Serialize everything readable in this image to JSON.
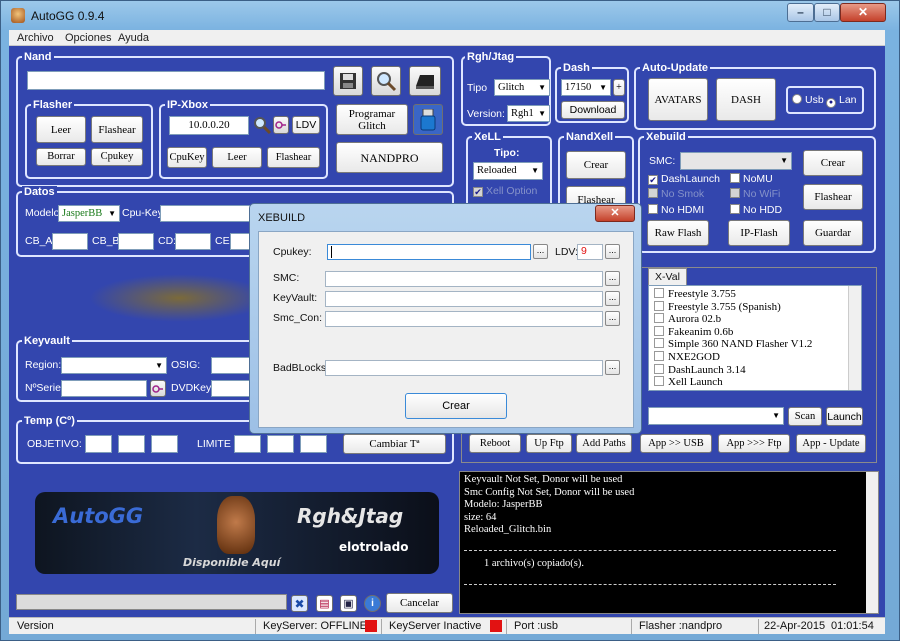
{
  "window": {
    "title": "AutoGG 0.9.4",
    "minimize": "–",
    "maximize": "□",
    "close": "✕"
  },
  "menu": [
    "Archivo",
    "Opciones",
    "Ayuda"
  ],
  "nand": {
    "title": "Nand",
    "path": ""
  },
  "flasher": {
    "title": "Flasher",
    "leer": "Leer",
    "flashear": "Flashear",
    "borrar": "Borrar",
    "cpukey": "Cpukey"
  },
  "ipxbox": {
    "title": "IP-Xbox",
    "ip": "10.0.0.20",
    "ldv": "LDV",
    "cpukey": "CpuKey",
    "leer": "Leer",
    "flashear": "Flashear"
  },
  "programar": {
    "label": "Programar Glitch",
    "nandpro": "NANDPRO"
  },
  "datos": {
    "title": "Datos",
    "modelo_label": "Modelo:",
    "modelo": "JasperBB",
    "cpukey_label": "Cpu-Key",
    "cba": "CB_A:",
    "cbb": "CB_B:",
    "cd": "CD:",
    "ce": "CE:"
  },
  "keyvault": {
    "title": "Keyvault",
    "region": "Region:",
    "osig": "OSIG:",
    "nserie": "NºSerie:",
    "dvdkey": "DVDKey"
  },
  "temp": {
    "title": "Temp (Cº)",
    "objetivo": "OBJETIVO:",
    "limite": "LIMITE",
    "cambiar": "Cambiar Tª"
  },
  "rgh": {
    "title": "Rgh/Jtag",
    "tipo_label": "Tipo",
    "tipo": "Glitch",
    "version_label": "Version:",
    "version": "Rgh1"
  },
  "dash": {
    "title": "Dash",
    "value": "17150",
    "plus": "+",
    "download": "Download"
  },
  "autoupdate": {
    "title": "Auto-Update",
    "avatars": "AVATARS",
    "dash": "DASH",
    "usb": "Usb",
    "lan": "Lan"
  },
  "xell": {
    "title": "XeLL",
    "tipo_label": "Tipo:",
    "tipo": "Reloaded",
    "option": "Xell Option"
  },
  "nandxell": {
    "title": "NandXell",
    "crear": "Crear",
    "flashear": "Flashear"
  },
  "xebuild": {
    "title": "Xebuild",
    "smc_label": "SMC:",
    "dashlaunch": "DashLaunch",
    "nomu": "NoMU",
    "nosmok": "No Smok",
    "nowifi": "No WiFi",
    "nohdmi": "No HDMI",
    "nohdd": "No HDD",
    "crear": "Crear",
    "flashear": "Flashear",
    "guardar": "Guardar",
    "rawflash": "Raw Flash",
    "ipflash": "IP-Flash"
  },
  "apps": {
    "tab": "X-Val",
    "items": [
      "Freestyle 3.755",
      "Freestyle 3.755 (Spanish)",
      "Aurora 02.b",
      "Fakeanim 0.6b",
      "Simple 360 NAND Flasher V1.2",
      "NXE2GOD",
      "DashLaunch 3.14",
      "Xell Launch"
    ],
    "scan": "Scan",
    "launch": "Launch",
    "reboot": "Reboot",
    "upftp": "Up Ftp",
    "addpaths": "Add Paths",
    "appusb": "App >> USB",
    "appftp": "App >>> Ftp",
    "appupdate": "App - Update"
  },
  "log": {
    "lines": [
      "Keyvault Not Set, Donor will be used",
      "Smc Config Not Set, Donor will be used",
      "Modelo: JasperBB",
      "size: 64",
      "Reloaded_Glitch.bin"
    ],
    "copied": "1 archivo(s) copiado(s)."
  },
  "banner": {
    "left": "AutoGG",
    "right": "Rgh&Jtag",
    "sub": "Disponible Aquí",
    "brand": "elotrolado"
  },
  "bottom": {
    "cancelar": "Cancelar"
  },
  "status": {
    "version": "Version",
    "keyserver": "KeyServer: OFFLINE",
    "keyserver_state": "KeyServer Inactive",
    "port": "Port :usb",
    "flasher": "Flasher :nandpro",
    "date": "22-Apr-2015",
    "time": "01:01:54"
  },
  "dialog": {
    "title": "XEBUILD",
    "cpukey": "Cpukey:",
    "ldv": "LDV:",
    "ldv_value": "9",
    "smc": "SMC:",
    "keyvault": "KeyVault:",
    "smccon": "Smc_Con:",
    "badblocks": "BadBLocks:",
    "crear": "Crear",
    "ellipsis": "...",
    "close": "✕"
  },
  "colors": {
    "client": "#3346ae",
    "red": "#e21212"
  }
}
